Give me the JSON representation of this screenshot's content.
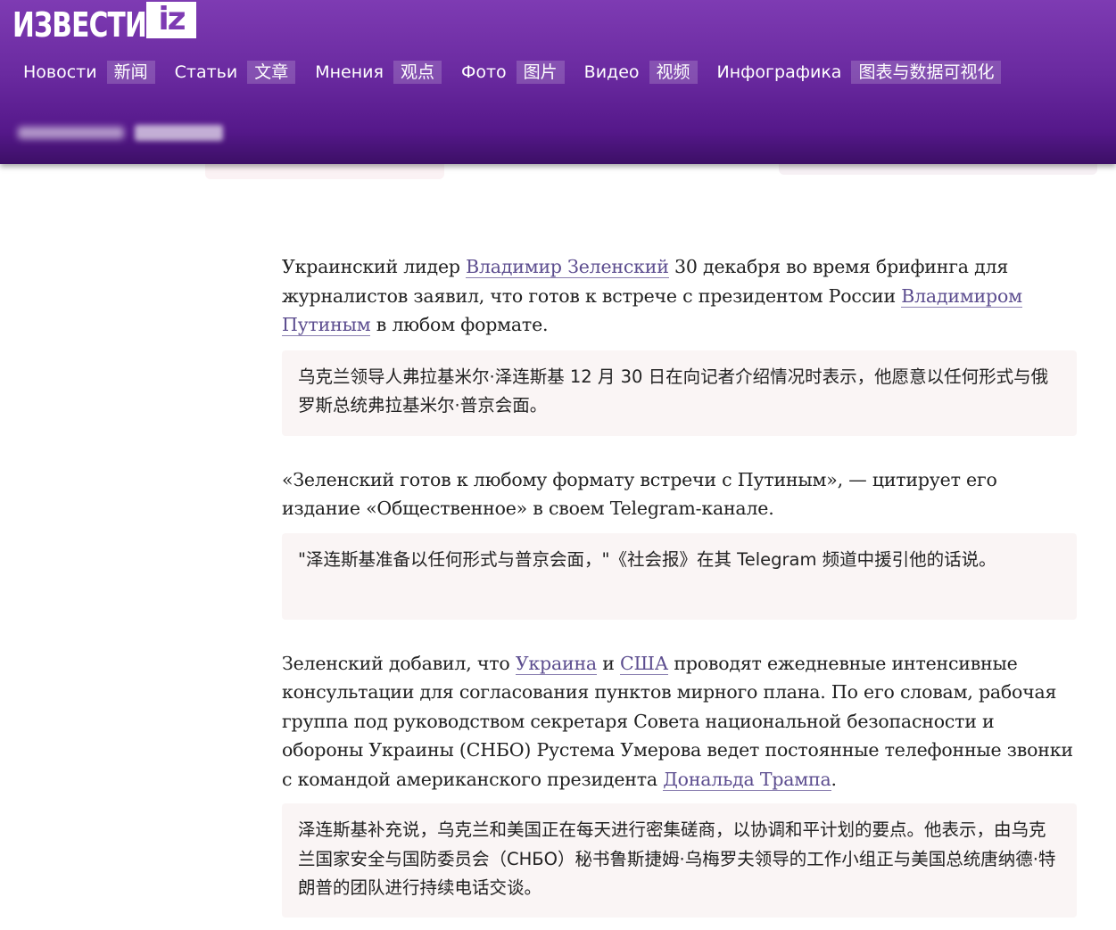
{
  "header": {
    "logo_text": "ИЗВЕСТИЯ",
    "logo_badge": "iz",
    "nav": [
      {
        "ru": "Новости",
        "zh": "新闻"
      },
      {
        "ru": "Статьи",
        "zh": "文章"
      },
      {
        "ru": "Мнения",
        "zh": "观点"
      },
      {
        "ru": "Фото",
        "zh": "图片"
      },
      {
        "ru": "Видео",
        "zh": "视频"
      },
      {
        "ru": "Инфографика",
        "zh": "图表与数据可视化"
      }
    ]
  },
  "article": {
    "p1": {
      "t1": "Украинский лидер ",
      "link1": "Владимир Зеленский",
      "t2": " 30 декабря во время брифинга для журналистов заявил, что готов к встрече с президентом России ",
      "link2": "Владимиром Путиным",
      "t3": " в любом формате."
    },
    "tr1": "乌克兰领导人弗拉基米尔·泽连斯基 12 月 30 日在向记者介绍情况时表示，他愿意以任何形式与俄罗斯总统弗拉基米尔·普京会面。",
    "p2": "«Зеленский готов к любому формату встречи с Путиным», — цитирует его издание «Общественное» в своем Telegram-канале.",
    "tr2": "\"泽连斯基准备以任何形式与普京会面，\"《社会报》在其 Telegram 频道中援引他的话说。",
    "p3": {
      "t1": "Зеленский добавил, что ",
      "link1": "Украина",
      "t2": " и ",
      "link2": "США",
      "t3": " проводят ежедневные интенсивные консультации для согласования пунктов мирного плана. По его словам, рабочая группа под руководством секретаря Совета национальной безопасности и обороны Украины (СНБО) Рустема Умерова ведет постоянные телефонные звонки с командой американского президента ",
      "link3": "Дональда Трампа",
      "t4": "."
    },
    "tr3": "泽连斯基补充说，乌克兰和美国正在每天进行密集磋商，以协调和平计划的要点。他表示，由乌克兰国家安全与国防委员会（СНБО）秘书鲁斯捷姆·乌梅罗夫领导的工作小组正与美国总统唐纳德·特朗普的团队进行持续电话交谈。"
  }
}
